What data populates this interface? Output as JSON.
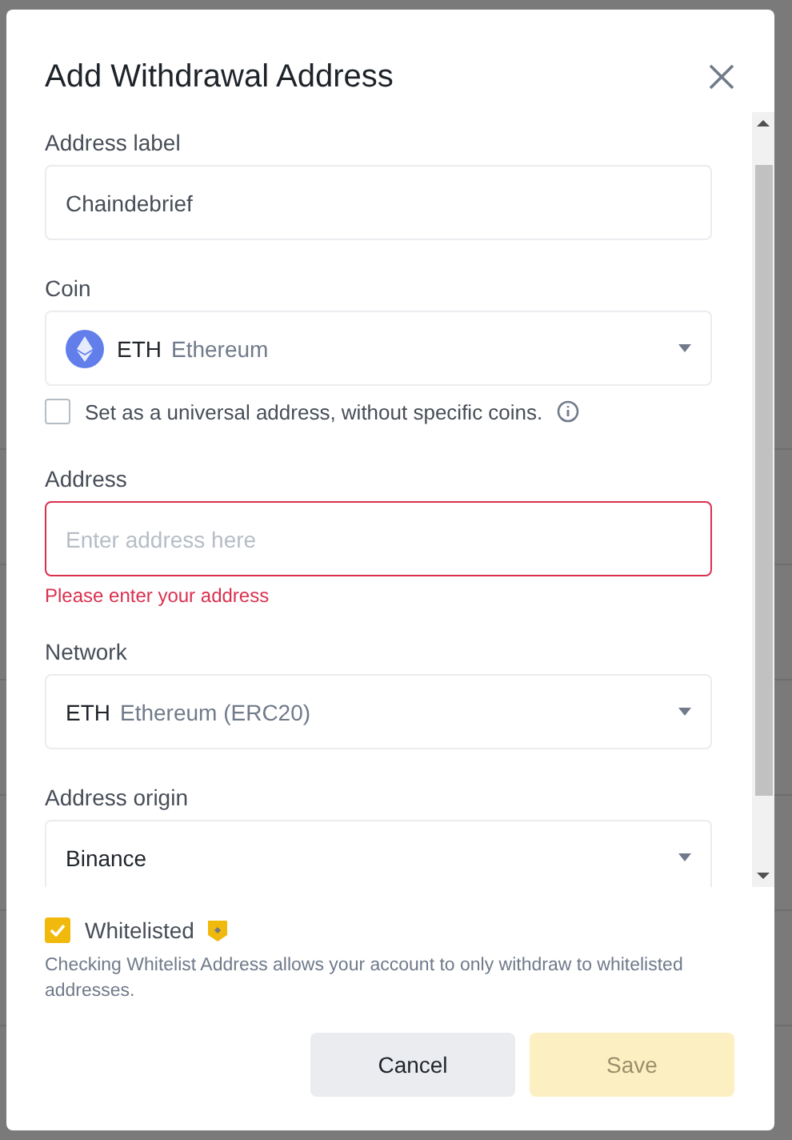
{
  "dialog": {
    "title": "Add Withdrawal Address",
    "fields": [
      {
        "kind": "text",
        "label": "Address label",
        "value": "Chaindebrief"
      },
      {
        "kind": "coin-select",
        "label": "Coin",
        "symbol": "ETH",
        "name": "Ethereum"
      },
      {
        "kind": "checkbox",
        "label": "Set as a universal address, without specific coins.",
        "checked": false
      },
      {
        "kind": "text",
        "label": "Address",
        "placeholder": "Enter address here",
        "error": "Please enter your address"
      },
      {
        "kind": "select",
        "label": "Network",
        "symbol": "ETH",
        "name": "Ethereum (ERC20)"
      },
      {
        "kind": "select",
        "label": "Address origin",
        "name": "Binance"
      }
    ],
    "whitelist": {
      "label": "Whitelisted",
      "checked": true,
      "description": "Checking Whitelist Address allows your account to only withdraw to whitelisted addresses."
    },
    "buttons": [
      {
        "label": "Cancel",
        "kind": "secondary",
        "disabled": false
      },
      {
        "label": "Save",
        "kind": "primary",
        "disabled": true
      }
    ]
  }
}
